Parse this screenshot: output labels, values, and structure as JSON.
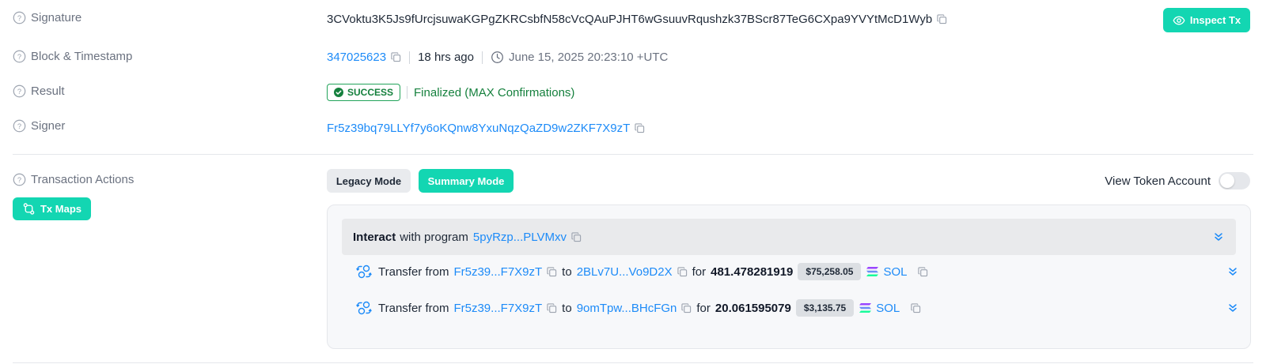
{
  "labels": {
    "signature": "Signature",
    "block_timestamp": "Block & Timestamp",
    "result": "Result",
    "signer": "Signer",
    "tx_actions": "Transaction Actions"
  },
  "signature": {
    "value": "3CVoktu3K5Js9fUrcjsuwaKGPgZKRCsbfN58cVcQAuPJHT6wGsuuvRqushzk37BScr87TeG6CXpa9YVYtMcD1Wyb",
    "inspect_label": "Inspect Tx"
  },
  "block": {
    "number": "347025623",
    "age": "18 hrs ago",
    "timestamp": "June 15, 2025 20:23:10 +UTC"
  },
  "result": {
    "status": "SUCCESS",
    "finality": "Finalized (MAX Confirmations)"
  },
  "signer": {
    "address": "Fr5z39bq79LLYf7y6oKQnw8YxuNqzQaZD9w2ZKF7X9zT"
  },
  "actions": {
    "tx_maps_label": "Tx Maps",
    "legacy_mode": "Legacy Mode",
    "summary_mode": "Summary Mode",
    "view_token_account": "View Token Account",
    "view_token_account_on": false,
    "interact": {
      "verb": "Interact",
      "text": "with program",
      "program": "5pyRzp...PLVMxv"
    },
    "transfers": [
      {
        "prefix": "Transfer from",
        "from": "Fr5z39...F7X9zT",
        "to_word": "to",
        "to": "2BLv7U...Vo9D2X",
        "for_word": "for",
        "amount": "481.478281919",
        "usd": "$75,258.05",
        "token": "SOL"
      },
      {
        "prefix": "Transfer from",
        "from": "Fr5z39...F7X9zT",
        "to_word": "to",
        "to": "9omTpw...BHcFGn",
        "for_word": "for",
        "amount": "20.061595079",
        "usd": "$3,135.75",
        "token": "SOL"
      }
    ]
  },
  "colors": {
    "accent": "#13d6b2",
    "link": "#1d8bf8",
    "success": "#15803d"
  }
}
